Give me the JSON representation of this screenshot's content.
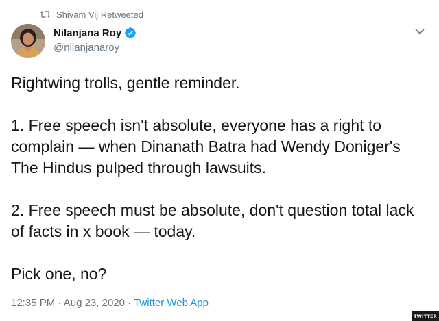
{
  "retweet": {
    "icon": "retweet-icon",
    "text": "Shivam Vij Retweeted"
  },
  "author": {
    "display_name": "Nilanjana Roy",
    "handle": "@nilanjanaroy",
    "verified": true,
    "avatar": "avatar"
  },
  "menu": {
    "icon": "chevron-down-icon"
  },
  "tweet": {
    "paragraphs": [
      "Rightwing trolls, gentle reminder.",
      "1. Free speech isn't absolute, everyone has a right to complain — when Dinanath Batra had Wendy Doniger's The Hindus pulped through lawsuits.",
      "2. Free speech must be absolute, don't question total lack of facts in x book — today.",
      "Pick one, no?"
    ]
  },
  "meta": {
    "time": "12:35 PM",
    "separator": " · ",
    "date": "Aug 23, 2020",
    "source": "Twitter Web App"
  },
  "watermark": {
    "text": "TWITTER"
  },
  "colors": {
    "text_primary": "#14171a",
    "text_secondary": "#657786",
    "link": "#1b95e0",
    "verified": "#1da1f2"
  }
}
